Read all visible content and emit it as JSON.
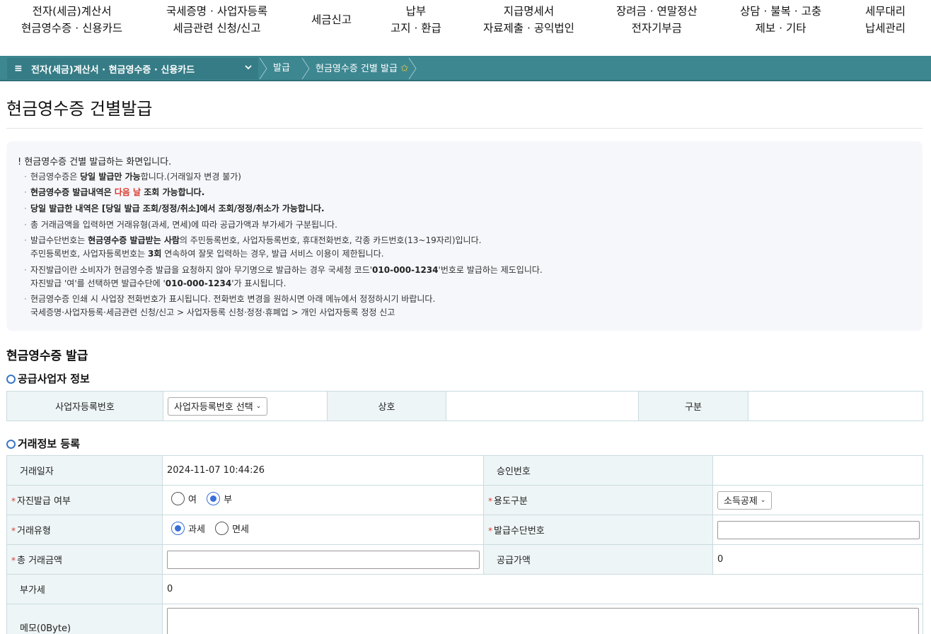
{
  "topnav": [
    {
      "line1": "전자(세금)계산서",
      "line2": "현금영수증 · 신용카드"
    },
    {
      "line1": "국세증명 · 사업자등록",
      "line2": "세금관련 신청/신고"
    },
    {
      "line1": "세금신고",
      "line2": ""
    },
    {
      "line1": "납부",
      "line2": "고지 · 환급"
    },
    {
      "line1": "지급명세서",
      "line2": "자료제출 · 공익법인"
    },
    {
      "line1": "장려금 · 연말정산",
      "line2": "전자기부금"
    },
    {
      "line1": "상담 · 불복 · 고충",
      "line2": "제보 · 기타"
    },
    {
      "line1": "세무대리",
      "line2": "납세관리"
    }
  ],
  "breadcrumb": {
    "menu_icon": "≡",
    "main": "전자(세금)계산서 · 현금영수증 · 신용카드",
    "item1": "발급",
    "item2": "현금영수증 건별 발급",
    "star": "✩"
  },
  "page_title": "현금영수증 건별발급",
  "notice": {
    "head": "! 현금영수증 건별 발급하는 화면입니다.",
    "l1a": "현금영수증은 ",
    "l1b": "당일 발급만 가능",
    "l1c": "합니다.(거래일자 변경 불가)",
    "l2a": "현금영수증 발급내역은 ",
    "l2b": "다음 날",
    "l2c": " 조회 가능합니다.",
    "l3": "당일 발급한 내역은 [당일 발급 조회/정정/취소]에서 조회/정정/취소가 가능합니다.",
    "l4": "총 거래금액을 입력하면 거래유형(과세, 면세)에 따라 공급가액과 부가세가 구분됩니다.",
    "l5a": "발급수단번호는 ",
    "l5b": "현금영수증 발급받는 사람",
    "l5c": "의  주민등록번호, 사업자등록번호, 휴대전화번호, 각종 카드번호(13~19자리)입니다.",
    "l5d": "주민등록번호, 사업자등록번호는 ",
    "l5e": "3회",
    "l5f": " 연속하여 잘못 입력하는 경우, 발급 서비스 이용이 제한됩니다.",
    "l6a": "자진발급이란 소비자가 현금영수증 발급을 요청하지 않아 무기명으로 발급하는 경우 국세청 코드'",
    "l6b": "010-000-1234",
    "l6c": "'번호로 발급하는 제도입니다.",
    "l6d": "자진발급 '여'를 선택하면 발급수단에 '",
    "l6e": "010-000-1234",
    "l6f": "'가 표시됩니다.",
    "l7": "현금영수증 인쇄 시 사업장 전화번호가 표시됩니다. 전화번호 변경을 원하시면 아래 메뉴에서 정정하시기 바랍니다.",
    "l7b": "국세증명·사업자등록·세금관련 신청/신고 > 사업자등록 신청·정정·휴폐업 > 개인 사업자등록 정정 신고"
  },
  "section_title": "현금영수증 발급",
  "supplier": {
    "title": "공급사업자 정보",
    "brn_label": "사업자등록번호",
    "brn_select": "사업자등록번호 선택",
    "name_label": "상호",
    "type_label": "구분"
  },
  "trade": {
    "title": "거래정보 등록",
    "date_label": "거래일자",
    "date_value": "2024-11-07 10:44:26",
    "approval_label": "승인번호",
    "self_label": "자진발급 여부",
    "self_yes": "여",
    "self_no": "부",
    "usage_label": "용도구분",
    "usage_select": "소득공제",
    "type_label": "거래유형",
    "type_tax": "과세",
    "type_free": "면세",
    "means_label": "발급수단번호",
    "total_label": "총 거래금액",
    "supply_label": "공급가액",
    "supply_value": "0",
    "vat_label": "부가세",
    "vat_value": "0",
    "memo_label": "메모(0Byte)"
  }
}
